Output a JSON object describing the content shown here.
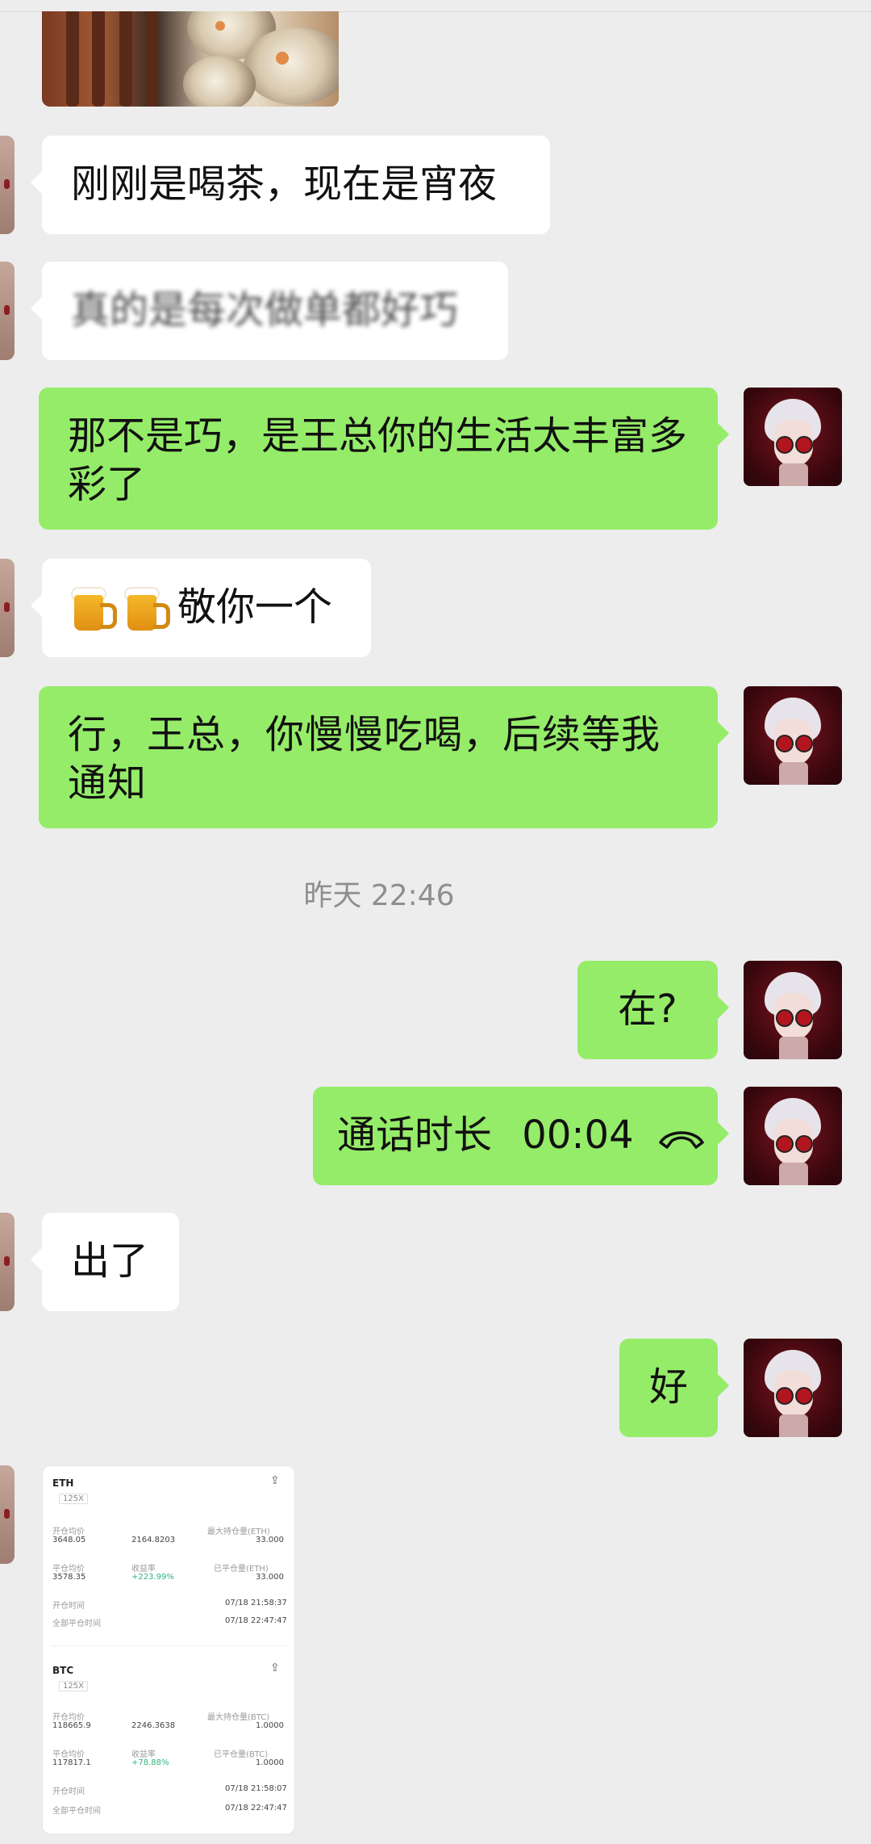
{
  "messages": {
    "m1": "刚刚是喝茶，现在是宵夜",
    "m2": "真的是每次做单都好巧",
    "m3": "那不是巧，是王总你的生活太丰富多彩了",
    "m4": "敬你一个",
    "m5": "行，王总，你慢慢吃喝，后续等我通知",
    "m6": "在?",
    "m7_label": "通话时长",
    "m7_duration": "00:04",
    "m8": "出了",
    "m9": "好"
  },
  "timestamp": "昨天 22:46",
  "icons": {
    "beer": "beer-mug-icon",
    "phone": "phone-hangup-icon"
  },
  "colors": {
    "outgoing_bubble": "#95ec69",
    "incoming_bubble": "#ffffff",
    "background": "#ededed"
  },
  "card": {
    "pos1": {
      "symbol": "ETH",
      "leverage": "125X",
      "label_open_avg": "开仓均价",
      "value_open_avg": "3648.05",
      "value_mid_1": "2164.8203",
      "label_max_hold": "最大持仓量(ETH)",
      "value_max_hold": "33.000",
      "label_close_avg": "平仓均价",
      "value_close_avg": "3578.35",
      "label_yield": "收益率",
      "value_yield": "+223.99%",
      "label_closed": "已平仓量(ETH)",
      "value_closed": "33.000",
      "label_open_time": "开仓时间",
      "value_open_time": "07/18 21:58:37",
      "label_full_close": "全部平仓时间",
      "value_full_close": "07/18 22:47:47"
    },
    "pos2": {
      "symbol": "BTC",
      "leverage": "125X",
      "label_open_avg": "开仓均价",
      "value_open_avg": "118665.9",
      "value_mid_1": "2246.3638",
      "label_max_hold": "最大持仓量(BTC)",
      "value_max_hold": "1.0000",
      "label_close_avg": "平仓均价",
      "value_close_avg": "117817.1",
      "label_yield": "收益率",
      "value_yield": "+78.88%",
      "label_closed": "已平仓量(BTC)",
      "value_closed": "1.0000",
      "label_open_time": "开仓时间",
      "value_open_time": "07/18 21:58:07",
      "label_full_close": "全部平仓时间",
      "value_full_close": "07/18 22:47:47"
    }
  }
}
